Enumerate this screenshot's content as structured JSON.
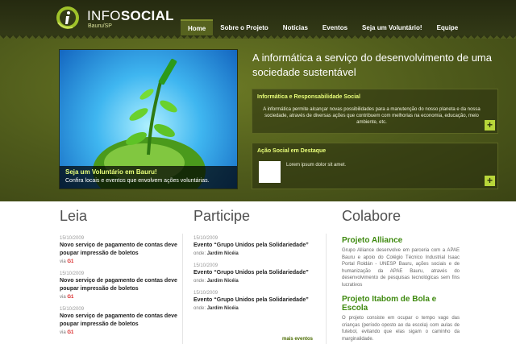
{
  "logo": {
    "name_thin": "INFO",
    "name_bold": "SOCIAL",
    "location": "Bauru/SP"
  },
  "nav": [
    "Home",
    "Sobre o Projeto",
    "Notícias",
    "Eventos",
    "Seja um Voluntário!",
    "Equipe"
  ],
  "hero": {
    "headline": "A informática a serviço do desenvolvimento de uma sociedade sustentável",
    "caption_title": "Seja um Voluntário em Bauru!",
    "caption_text": "Confira locais e eventos que envolvem ações voluntárias."
  },
  "panels": [
    {
      "title": "Informática e Responsabilidade Social",
      "text": "A informática permite alcançar novas possibilidades para a manutenção do nosso planeta e da nossa sociedade, através de diversas ações que contribuem com melhorias na economia, educação, meio ambiente, etc."
    },
    {
      "title": "Ação Social em Destaque",
      "text": "Lorem ipsum dolor sit amet."
    }
  ],
  "plus_label": "+",
  "leia": {
    "heading": "Leia",
    "items": [
      {
        "date": "15/10/2009",
        "title": "Novo serviço de pagamento de contas deve poupar impressão de boletos",
        "via_label": "via",
        "source": "G1"
      },
      {
        "date": "15/10/2009",
        "title": "Novo serviço de pagamento de contas deve poupar impressão de boletos",
        "via_label": "via",
        "source": "G1"
      },
      {
        "date": "15/10/2009",
        "title": "Novo serviço de pagamento de contas deve poupar impressão de boletos",
        "via_label": "via",
        "source": "G1"
      }
    ]
  },
  "participe": {
    "heading": "Participe",
    "items": [
      {
        "date": "15/10/2009",
        "title": "Evento  “Grupo Unidos pela Solidariedade”",
        "where_label": "onde:",
        "place": "Jardim Nicéia"
      },
      {
        "date": "15/10/2009",
        "title": "Evento  “Grupo Unidos pela Solidariedade”",
        "where_label": "onde:",
        "place": "Jardim Nicéia"
      },
      {
        "date": "15/10/2009",
        "title": "Evento  “Grupo Unidos pela Solidariedade”",
        "where_label": "onde:",
        "place": "Jardim Nicéia"
      }
    ],
    "more": "mais eventos"
  },
  "colabore": {
    "heading": "Colabore",
    "projects": [
      {
        "title": "Projeto Alliance",
        "text": "Grupo Alliance desenvolve em parceria com a APAE Bauru e apoio do Colégio Técnico Industrial Isaac Portal Roldán - UNESP Bauru, ações sociais e de humanização da APAE Bauru, através do desenvolvimento de pesquisas tecnológicas sem fins lucrativos"
      },
      {
        "title": "Projeto Itabom de Bola e Escola",
        "text": "O projeto consiste em ocupar o tempo vago das crianças (período oposto ao da escola) com aulas de futebol, evitando que elas sigam o caminho da marginalidade."
      }
    ]
  },
  "colors": {
    "nav_active": "#56621f",
    "accent_green": "#e9ff7a",
    "project_title": "#3f8a10",
    "source_red": "#d81e1e"
  }
}
